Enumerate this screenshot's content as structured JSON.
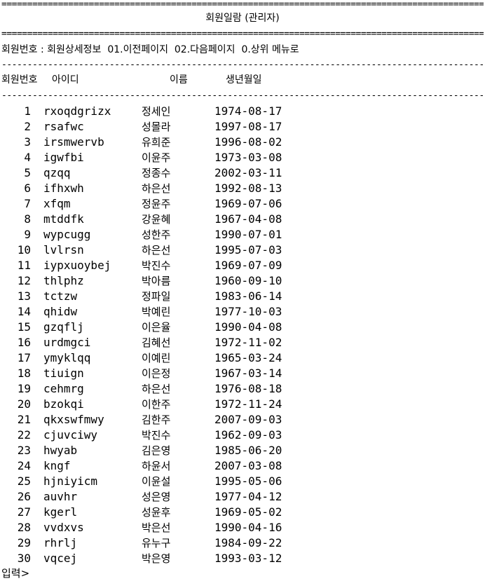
{
  "console": {
    "rule_double": "=========================================================================================================",
    "rule_single": "---------------------------------------------------------------------------------------------------------",
    "title": "회원일람 (관리자)",
    "menu": "회원번호 : 회원상세정보  01.이전페이지  02.다음페이지  0.상위 메뉴로",
    "columns": {
      "no": "회원번호",
      "id": "아이디",
      "name": "이름",
      "birth": "생년월일"
    },
    "rows": [
      {
        "no": "1",
        "id": "rxoqdgrizx",
        "name": "정세인",
        "birth": "1974-08-17"
      },
      {
        "no": "2",
        "id": "rsafwc",
        "name": "성몰라",
        "birth": "1997-08-17"
      },
      {
        "no": "3",
        "id": "irsmwervb",
        "name": "유희준",
        "birth": "1996-08-02"
      },
      {
        "no": "4",
        "id": "igwfbi",
        "name": "이윤주",
        "birth": "1973-03-08"
      },
      {
        "no": "5",
        "id": "qzqq",
        "name": "정종수",
        "birth": "2002-03-11"
      },
      {
        "no": "6",
        "id": "ifhxwh",
        "name": "하은선",
        "birth": "1992-08-13"
      },
      {
        "no": "7",
        "id": "xfqm",
        "name": "정윤주",
        "birth": "1969-07-06"
      },
      {
        "no": "8",
        "id": "mtddfk",
        "name": "강윤혜",
        "birth": "1967-04-08"
      },
      {
        "no": "9",
        "id": "wypcugg",
        "name": "성한주",
        "birth": "1990-07-01"
      },
      {
        "no": "10",
        "id": "lvlrsn",
        "name": "하은선",
        "birth": "1995-07-03"
      },
      {
        "no": "11",
        "id": "iypxuoybej",
        "name": "박진수",
        "birth": "1969-07-09"
      },
      {
        "no": "12",
        "id": "thlphz",
        "name": "박아름",
        "birth": "1960-09-10"
      },
      {
        "no": "13",
        "id": "tctzw",
        "name": "정파일",
        "birth": "1983-06-14"
      },
      {
        "no": "14",
        "id": "qhidw",
        "name": "박예린",
        "birth": "1977-10-03"
      },
      {
        "no": "15",
        "id": "gzqflj",
        "name": "이은율",
        "birth": "1990-04-08"
      },
      {
        "no": "16",
        "id": "urdmgci",
        "name": "김혜선",
        "birth": "1972-11-02"
      },
      {
        "no": "17",
        "id": "ymyklqq",
        "name": "이예린",
        "birth": "1965-03-24"
      },
      {
        "no": "18",
        "id": "tiuign",
        "name": "이은정",
        "birth": "1967-03-14"
      },
      {
        "no": "19",
        "id": "cehmrg",
        "name": "하은선",
        "birth": "1976-08-18"
      },
      {
        "no": "20",
        "id": "bzokqi",
        "name": "이한주",
        "birth": "1972-11-24"
      },
      {
        "no": "21",
        "id": "qkxswfmwy",
        "name": "김한주",
        "birth": "2007-09-03"
      },
      {
        "no": "22",
        "id": "cjuvciwy",
        "name": "박진수",
        "birth": "1962-09-03"
      },
      {
        "no": "23",
        "id": "hwyab",
        "name": "김은영",
        "birth": "1985-06-20"
      },
      {
        "no": "24",
        "id": "kngf",
        "name": "하윤서",
        "birth": "2007-03-08"
      },
      {
        "no": "25",
        "id": "hjniyicm",
        "name": "이윤설",
        "birth": "1995-05-06"
      },
      {
        "no": "26",
        "id": "auvhr",
        "name": "성은영",
        "birth": "1977-04-12"
      },
      {
        "no": "27",
        "id": "kgerl",
        "name": "성윤후",
        "birth": "1969-05-02"
      },
      {
        "no": "28",
        "id": "vvdxvs",
        "name": "박은선",
        "birth": "1990-04-16"
      },
      {
        "no": "29",
        "id": "rhrlj",
        "name": "유누구",
        "birth": "1984-09-22"
      },
      {
        "no": "30",
        "id": "vqcej",
        "name": "박은영",
        "birth": "1993-03-12"
      }
    ],
    "prompt": "입력>"
  }
}
